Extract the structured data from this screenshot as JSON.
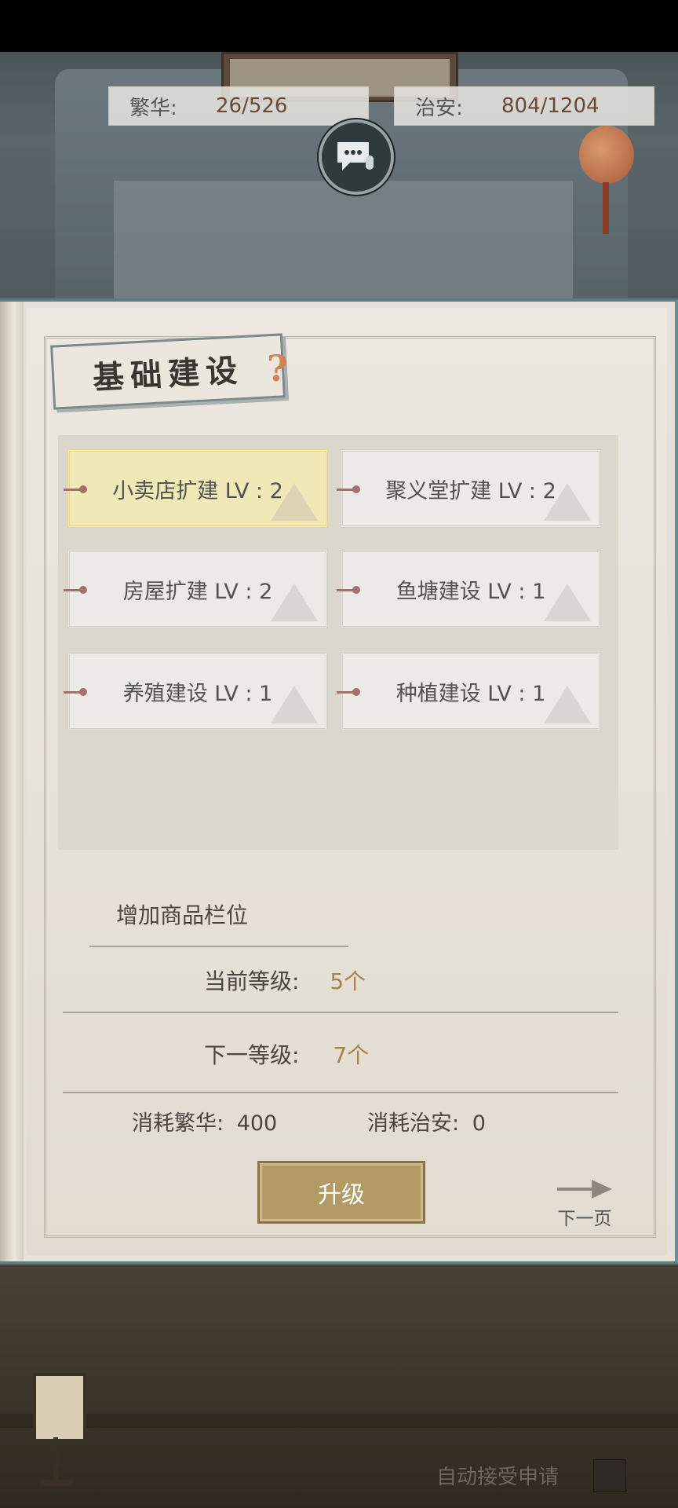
{
  "stats": {
    "prosperity_label": "繁华:",
    "prosperity_value": "26/526",
    "security_label": "治安:",
    "security_value": "804/1204"
  },
  "panel": {
    "title": "基础建设",
    "help_icon": "question-mark-icon",
    "upgrades": [
      {
        "label": "小卖店扩建 LV : 2",
        "selected": true
      },
      {
        "label": "聚义堂扩建 LV : 2",
        "selected": false
      },
      {
        "label": "房屋扩建 LV : 2",
        "selected": false
      },
      {
        "label": "鱼塘建设 LV : 1",
        "selected": false
      },
      {
        "label": "养殖建设 LV : 1",
        "selected": false
      },
      {
        "label": "种植建设 LV : 1",
        "selected": false
      }
    ],
    "detail": {
      "title": "增加商品栏位",
      "current_label": "当前等级:",
      "current_value": "5个",
      "next_label": "下一等级:",
      "next_value": "7个",
      "cost_prosperity_label": "消耗繁华:",
      "cost_prosperity_value": "400",
      "cost_security_label": "消耗治安:",
      "cost_security_value": "0"
    },
    "upgrade_button": "升级",
    "next_page": "下一页"
  },
  "footer": {
    "auto_accept": "自动接受申请"
  },
  "colors": {
    "accent_gold": "#a3844a",
    "button_gold": "#b29a64",
    "selected_card": "#f2e9b5"
  }
}
